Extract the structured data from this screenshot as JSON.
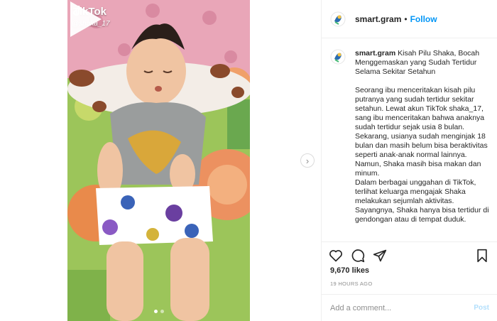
{
  "video": {
    "overlay_brand": "TikTok",
    "overlay_handle": "@shaka_17",
    "carousel_dots": 2,
    "active_dot": 0
  },
  "post": {
    "username": "smart.gram",
    "separator": "•",
    "follow_label": "Follow",
    "caption_title": "Kisah Pilu Shaka, Bocah Menggemaskan yang Sudah Tertidur Selama Sekitar Setahun",
    "caption_body": "Seorang ibu menceritakan kisah pilu putranya yang sudah tertidur sekitar setahun. Lewat akun TikTok shaka_17, sang ibu menceritakan bahwa anaknya sudah tertidur sejak usia 8 bulan.\nSekarang, usianya sudah menginjak 18 bulan dan masih belum bisa beraktivitas seperti anak-anak normal lainnya. Namun, Shaka masih bisa makan dan minum.\nDalam berbagai unggahan di TikTok, terlihat keluarga mengajak Shaka melakukan sejumlah aktivitas.\nSayangnya, Shaka hanya bisa tertidur di gendongan atau di tempat duduk.",
    "likes": "9,670 likes",
    "timestamp": "19 HOURS AGO",
    "comment_placeholder": "Add a comment...",
    "post_label": "Post"
  },
  "colors": {
    "accent": "#0095f6",
    "post_disabled": "#b2dffc"
  },
  "icons": [
    "heart-icon",
    "comment-icon",
    "share-icon",
    "bookmark-icon",
    "play-icon",
    "chevron-right-icon"
  ]
}
